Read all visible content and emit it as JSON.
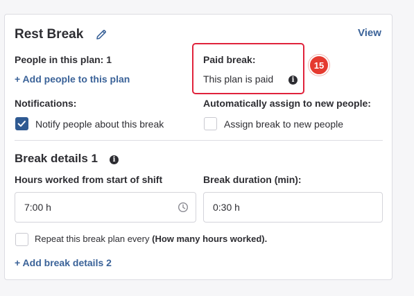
{
  "card": {
    "title": "Rest Break",
    "view_label": "View"
  },
  "people": {
    "label": "People in this plan: 1",
    "add_link": "+ Add people to this plan"
  },
  "paid_break": {
    "label": "Paid break:",
    "value": "This plan is paid",
    "annotation_number": "15"
  },
  "notifications": {
    "label": "Notifications:",
    "checkbox_label": "Notify people about this break",
    "checked": true
  },
  "auto_assign": {
    "label": "Automatically assign to new people:",
    "checkbox_label": "Assign break to new people",
    "checked": false
  },
  "break_details": {
    "title": "Break details 1",
    "hours_label": "Hours worked from start of shift",
    "hours_value": "7:00 h",
    "duration_label": "Break duration (min):",
    "duration_value": "0:30 h",
    "repeat_label": "Repeat this break plan every",
    "repeat_bold": "(How many hours worked).",
    "repeat_checked": false,
    "add_link": "+ Add break details 2"
  },
  "colors": {
    "accent": "#3a6298",
    "checkbox_checked": "#2f5a92",
    "annotation": "#e53a2f"
  }
}
